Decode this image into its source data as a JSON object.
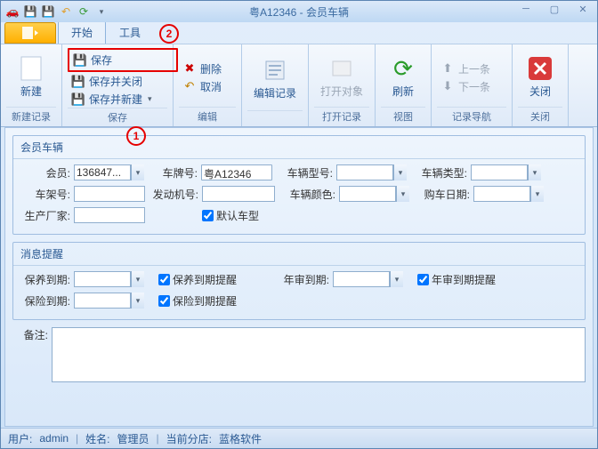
{
  "title": "粤A12346 - 会员车辆",
  "tabs": {
    "start": "开始",
    "tools": "工具"
  },
  "ribbon": {
    "new": "新建",
    "new_group": "新建记录",
    "save": "保存",
    "save_close": "保存并关闭",
    "save_new": "保存并新建",
    "save_group": "保存",
    "delete": "删除",
    "cancel": "取消",
    "edit_group": "编辑",
    "edit_record": "编辑记录",
    "open_obj": "打开对象",
    "open_group": "打开记录",
    "refresh": "刷新",
    "view_group": "视图",
    "prev": "上一条",
    "next": "下一条",
    "nav_group": "记录导航",
    "close": "关闭",
    "close_group": "关闭"
  },
  "vehicle": {
    "title": "会员车辆",
    "member_lbl": "会员:",
    "member_val": "136847...",
    "plate_lbl": "车牌号:",
    "plate_val": "粤A12346",
    "model_lbl": "车辆型号:",
    "type_lbl": "车辆类型:",
    "vin_lbl": "车架号:",
    "engine_lbl": "发动机号:",
    "color_lbl": "车辆颜色:",
    "buydate_lbl": "购车日期:",
    "maker_lbl": "生产厂家:",
    "default_model": "默认车型"
  },
  "remind": {
    "title": "消息提醒",
    "maint_to_lbl": "保养到期:",
    "maint_chk": "保养到期提醒",
    "inspect_to_lbl": "年审到期:",
    "inspect_chk": "年审到期提醒",
    "insure_to_lbl": "保险到期:",
    "insure_chk": "保险到期提醒"
  },
  "memo_lbl": "备注:",
  "status": {
    "user_lbl": "用户:",
    "user": "admin",
    "name_lbl": "姓名:",
    "name": "管理员",
    "branch_lbl": "当前分店:",
    "branch": "蓝格软件"
  },
  "annotations": {
    "n1": "1",
    "n2": "2"
  }
}
